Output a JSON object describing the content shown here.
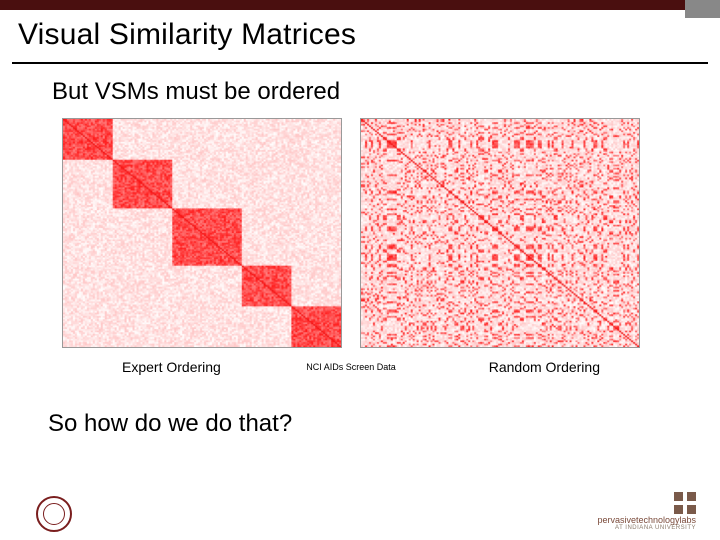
{
  "slide": {
    "title": "Visual Similarity Matrices",
    "body1": "But VSMs must be ordered",
    "body2": "So how do we do that?"
  },
  "labels": {
    "left": "Expert Ordering",
    "center": "NCI AIDs Screen Data",
    "right": "Random Ordering"
  },
  "footer": {
    "lab_name_html": "pervasivetechnologylabs",
    "lab_sub": "AT INDIANA UNIVERSITY"
  }
}
